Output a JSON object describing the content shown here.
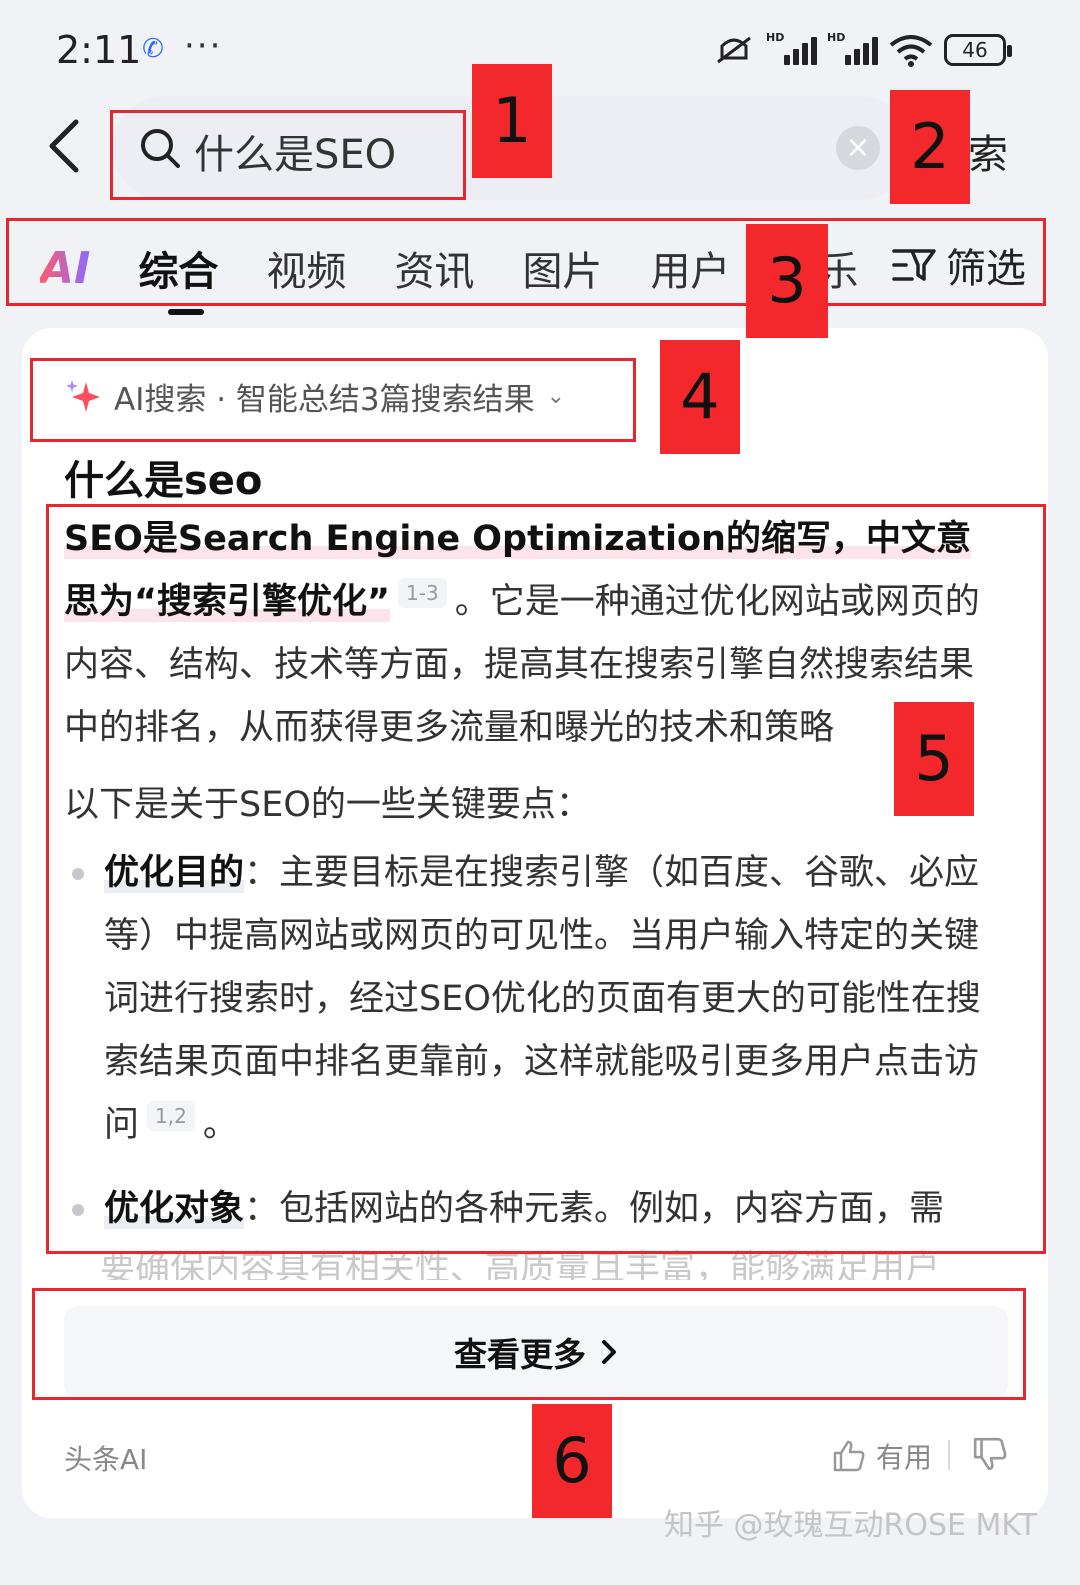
{
  "status": {
    "time": "2:11",
    "app_icon": "app-notification-icon",
    "dots": "···",
    "hd": "HD",
    "battery": "46"
  },
  "search": {
    "query": "什么是SEO",
    "clear_icon": "×",
    "go_label": "搜索"
  },
  "tabs": {
    "ai_label": "AI",
    "items": [
      "综合",
      "视频",
      "资讯",
      "图片",
      "用户",
      "音乐"
    ],
    "filter_label": "筛选"
  },
  "answer": {
    "chip_label": "AI搜索 · 智能总结3篇搜索结果",
    "title": "什么是seo",
    "p_bold": "SEO是Search Engine Optimization的缩写，中文意思为“搜索引擎优化”",
    "p_cite": "1-3",
    "p_rest": "。它是一种通过优化网站或网页的内容、结构、技术等方面，提高其在搜索引擎自然搜索结果中的排名，从而获得更多流量和曝光的技术和策略",
    "intro": "以下是关于SEO的一些关键要点：",
    "bullets": [
      {
        "term": "优化目的",
        "text": "：主要目标是在搜索引擎（如百度、谷歌、必应等）中提高网站或网页的可见性。当用户输入特定的关键词进行搜索时，经过SEO优化的页面有更大的可能性在搜索结果页面中排名更靠前，这样就能吸引更多用户点击访问",
        "cite": "1,2",
        "end": "。"
      },
      {
        "term": "优化对象",
        "text": "：包括网站的各种元素。例如，内容方面，需"
      }
    ],
    "fade_text": "要确保内容具有相关性、高质量且丰富，能够满足用户"
  },
  "more_label": "查看更多",
  "footer": {
    "source": "头条AI",
    "useful_label": "有用"
  },
  "watermark": "知乎 @玫瑰互动ROSE MKT",
  "annotations": [
    "1",
    "2",
    "3",
    "4",
    "5",
    "6"
  ],
  "colors": {
    "annotation_red": "#e8262d",
    "highlight_pink": "#fde4ea",
    "background": "#f1f2f6"
  }
}
